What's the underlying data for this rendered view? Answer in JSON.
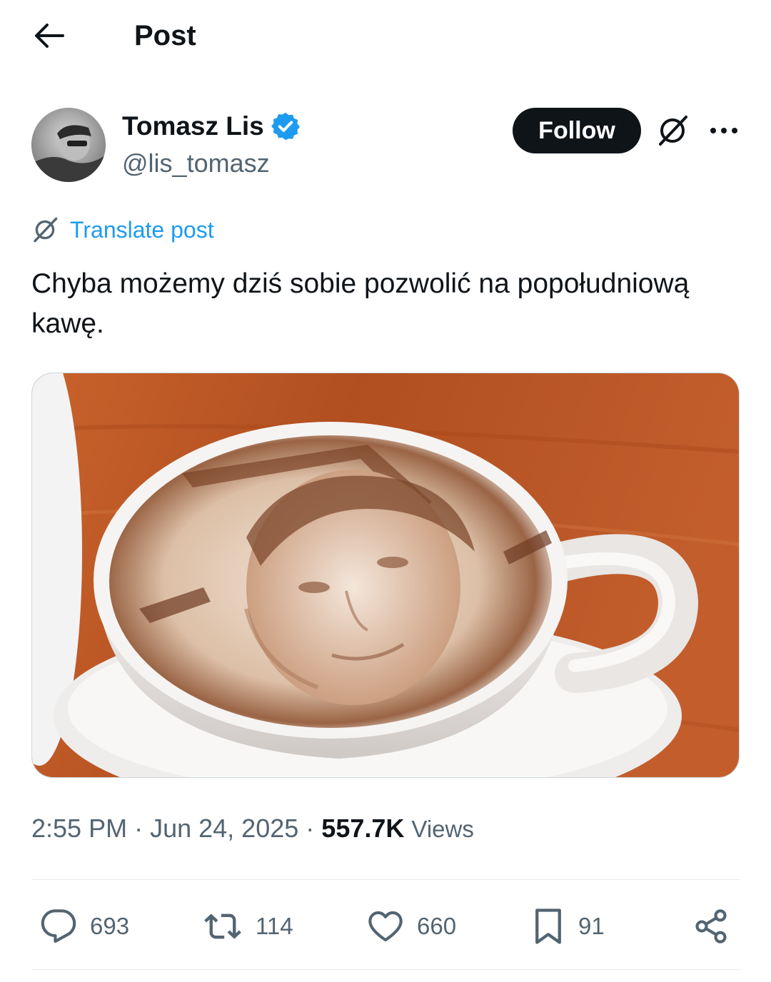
{
  "header": {
    "title": "Post"
  },
  "author": {
    "name": "Tomasz Lis",
    "handle": "@lis_tomasz"
  },
  "follow_label": "Follow",
  "translate_label": "Translate post",
  "tweet": {
    "text": "Chyba możemy dziś sobie pozwolić na popołudniową kawę."
  },
  "meta": {
    "time": "2:55 PM",
    "date": "Jun 24, 2025",
    "views_count": "557.7K",
    "views_label": "Views"
  },
  "actions": {
    "replies": "693",
    "reposts": "114",
    "likes": "660",
    "bookmarks": "91"
  },
  "colors": {
    "accent": "#1d9bf0",
    "text": "#0f1419",
    "muted": "#536471",
    "follow_bg": "#0f1419"
  },
  "icons": [
    "back-arrow-icon",
    "verified-badge-icon",
    "grok-icon",
    "more-options-icon",
    "translate-icon",
    "reply-icon",
    "repost-icon",
    "like-icon",
    "bookmark-icon",
    "share-icon"
  ]
}
